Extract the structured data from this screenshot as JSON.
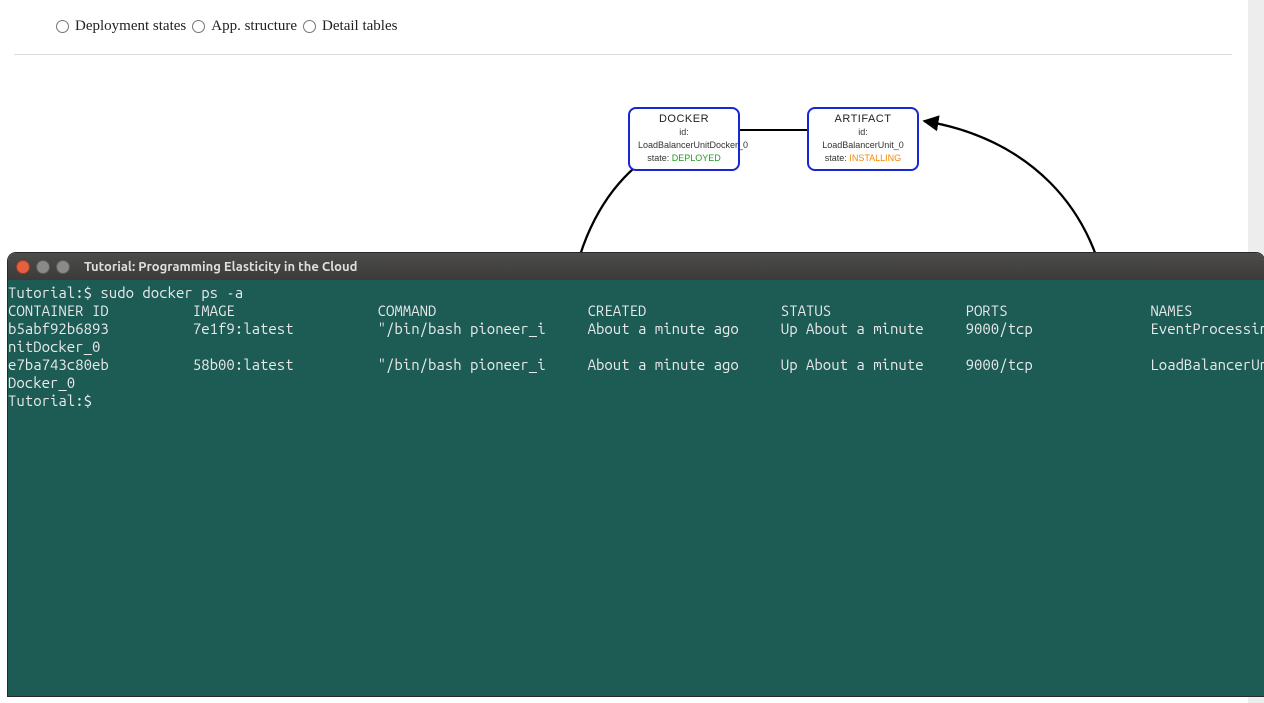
{
  "radios": {
    "deployment_states": "Deployment states",
    "app_structure": "App. structure",
    "detail_tables": "Detail tables"
  },
  "nodes": {
    "docker": {
      "title": "DOCKER",
      "id_label": "id: LoadBalancerUnitDocker_0",
      "state_key": "state:",
      "state_value": "DEPLOYED"
    },
    "artifact": {
      "title": "ARTIFACT",
      "id_label": "id: LoadBalancerUnit_0",
      "state_key": "state:",
      "state_value": "INSTALLING"
    }
  },
  "terminal": {
    "window_title": "Tutorial: Programming Elasticity in the Cloud",
    "prompt1": "Tutorial:$ ",
    "command": "sudo docker ps -a",
    "headers": {
      "container_id": "CONTAINER ID",
      "image": "IMAGE",
      "command": "COMMAND",
      "created": "CREATED",
      "status": "STATUS",
      "ports": "PORTS",
      "names": "NAMES"
    },
    "rows": [
      {
        "id": "b5abf92b6893",
        "image": "7e1f9:latest",
        "command": "\"/bin/bash pioneer_i",
        "created": "About a minute ago",
        "status": "Up About a minute",
        "ports": "9000/tcp",
        "names_line1": "EventProcessingU",
        "names_line2": "nitDocker_0"
      },
      {
        "id": "e7ba743c80eb",
        "image": "58b00:latest",
        "command": "\"/bin/bash pioneer_i",
        "created": "About a minute ago",
        "status": "Up About a minute",
        "ports": "9000/tcp",
        "names_line1": "LoadBalancerUnit",
        "names_line2": "Docker_0"
      }
    ],
    "prompt2": "Tutorial:$ "
  }
}
